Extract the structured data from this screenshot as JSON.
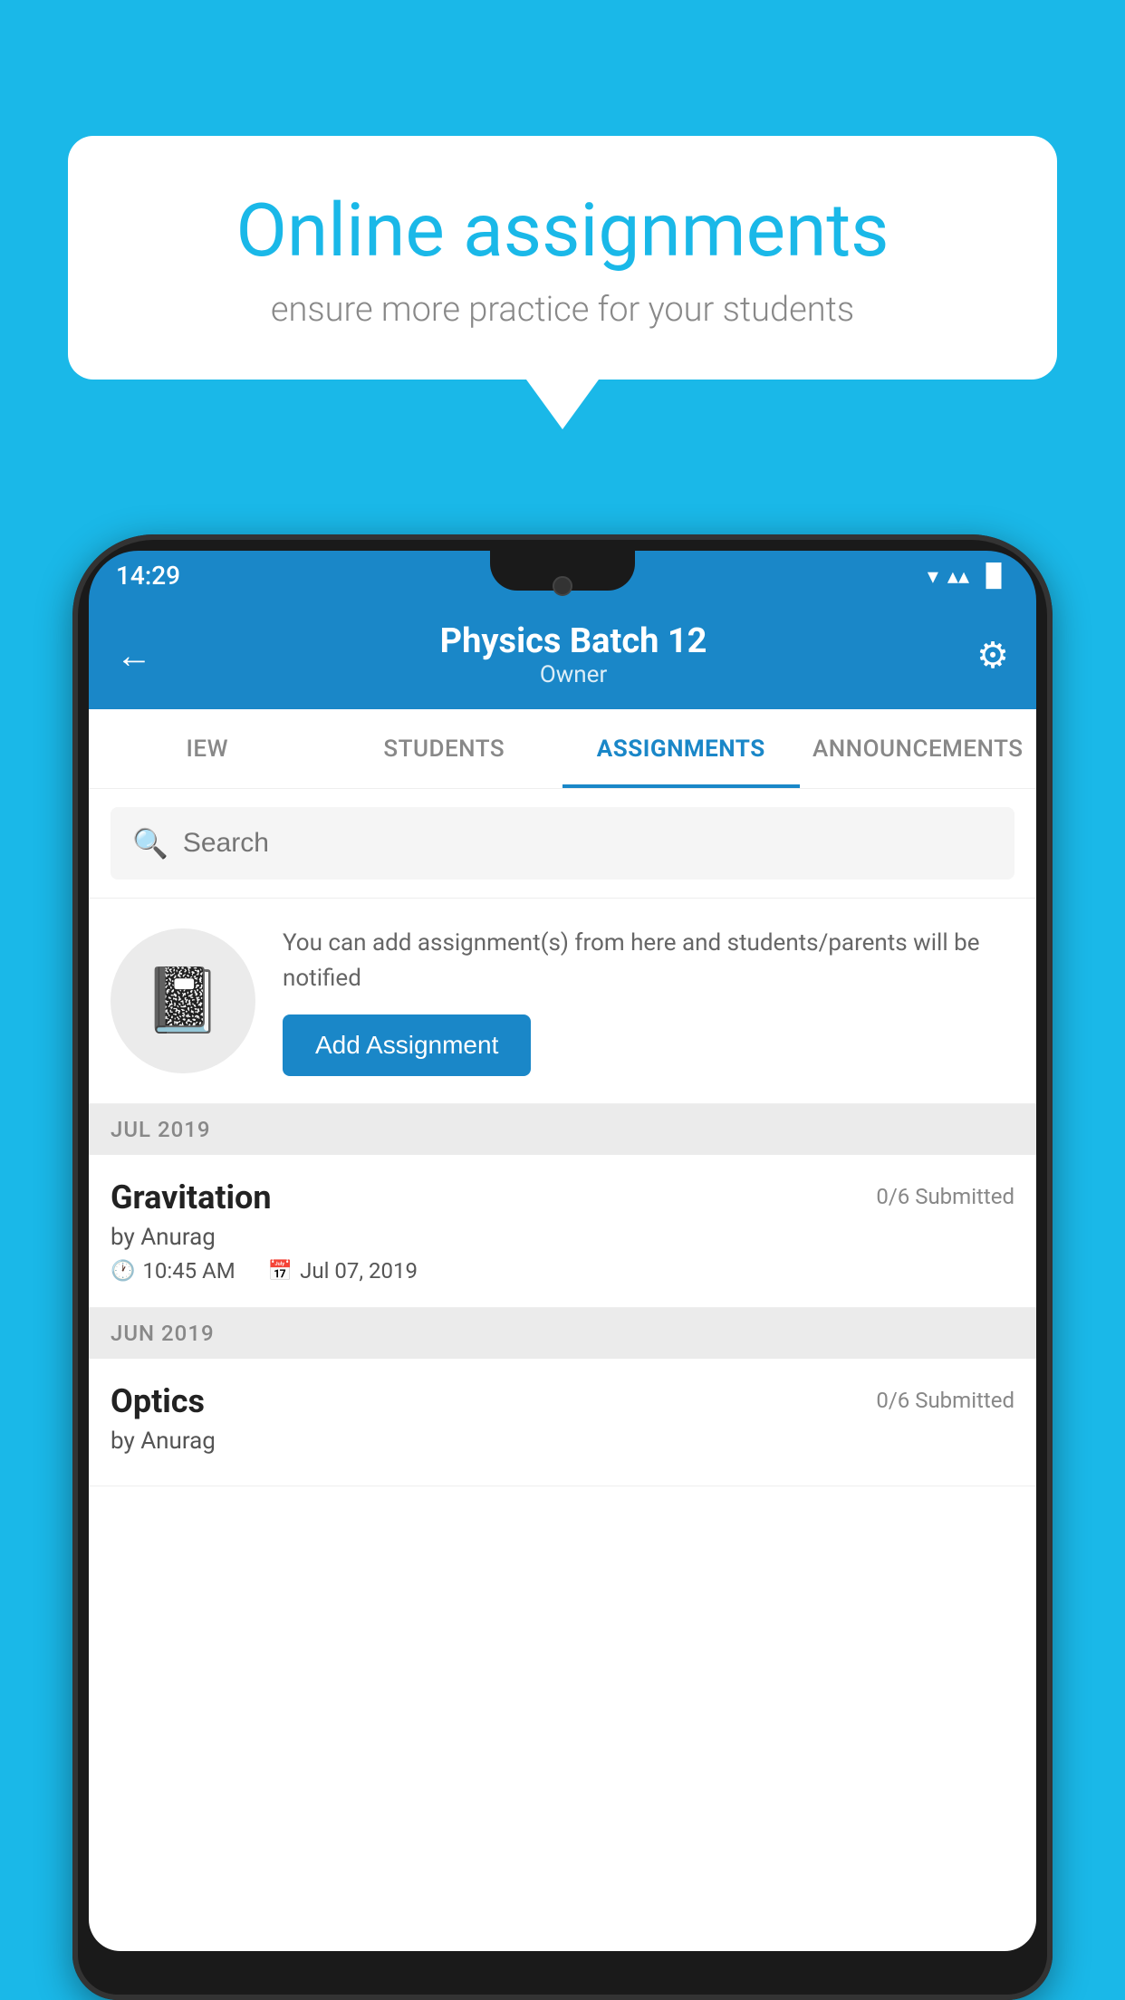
{
  "background_color": "#1ab8e8",
  "speech_bubble": {
    "title": "Online assignments",
    "subtitle": "ensure more practice for your students"
  },
  "status_bar": {
    "time": "14:29",
    "wifi_icon": "▼",
    "signal_icon": "▲",
    "battery_icon": "▐"
  },
  "app_bar": {
    "title": "Physics Batch 12",
    "subtitle": "Owner",
    "back_label": "←",
    "settings_label": "⚙"
  },
  "tabs": [
    {
      "label": "IEW",
      "active": false
    },
    {
      "label": "STUDENTS",
      "active": false
    },
    {
      "label": "ASSIGNMENTS",
      "active": true
    },
    {
      "label": "ANNOUNCEMENTS",
      "active": false
    }
  ],
  "search": {
    "placeholder": "Search"
  },
  "add_promo": {
    "description": "You can add assignment(s) from here and students/parents will be notified",
    "button_label": "Add Assignment"
  },
  "assignment_sections": [
    {
      "month": "JUL 2019",
      "assignments": [
        {
          "name": "Gravitation",
          "submitted": "0/6 Submitted",
          "author": "by Anurag",
          "time": "10:45 AM",
          "date": "Jul 07, 2019"
        }
      ]
    },
    {
      "month": "JUN 2019",
      "assignments": [
        {
          "name": "Optics",
          "submitted": "0/6 Submitted",
          "author": "by Anurag",
          "time": "",
          "date": ""
        }
      ]
    }
  ]
}
